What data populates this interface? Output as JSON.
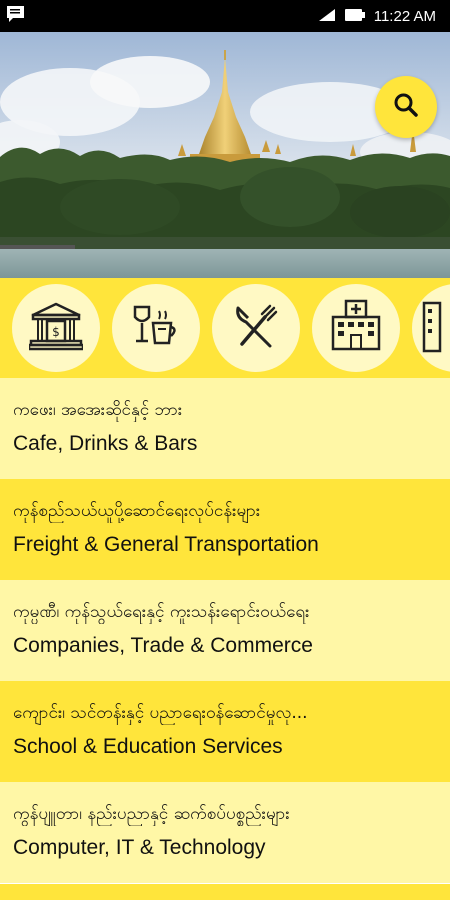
{
  "status_bar": {
    "time": "11:22 AM",
    "icons": [
      "chat-notification-icon",
      "signal-icon",
      "battery-icon"
    ]
  },
  "hero": {
    "image": "shwedagon-pagoda-lake-photo",
    "search_icon": "search-icon"
  },
  "categories": [
    {
      "icon": "bank-icon"
    },
    {
      "icon": "drinks-coffee-icon"
    },
    {
      "icon": "fork-knife-icon"
    },
    {
      "icon": "hospital-icon"
    },
    {
      "icon": "building-icon"
    }
  ],
  "list": [
    {
      "mm": "ကဖေး၊ အအေးဆိုင်နှင့် ဘား",
      "en": "Cafe, Drinks & Bars"
    },
    {
      "mm": "ကုန်စည်သယ်ယူပို့ဆောင်ရေးလုပ်ငန်းများ",
      "en": "Freight & General Transportation"
    },
    {
      "mm": "ကုမ္ပဏီ၊ ကုန်သွယ်ရေးနှင့် ကူးသန်းရောင်းဝယ်ရေး",
      "en": "Companies, Trade & Commerce"
    },
    {
      "mm": "ကျောင်း၊ သင်တန်းနှင့် ပညာရေးဝန်ဆောင်မှုလု...",
      "en": "School & Education Services"
    },
    {
      "mm": "ကွန်ပျူတာ၊ နည်းပညာနှင့် ဆက်စပ်ပစ္စည်းများ",
      "en": "Computer, IT & Technology"
    }
  ],
  "colors": {
    "accent": "#ffe53b",
    "row_light": "#fff7a6",
    "row_dark": "#fff38a",
    "icon_bg": "#fff9c4"
  }
}
